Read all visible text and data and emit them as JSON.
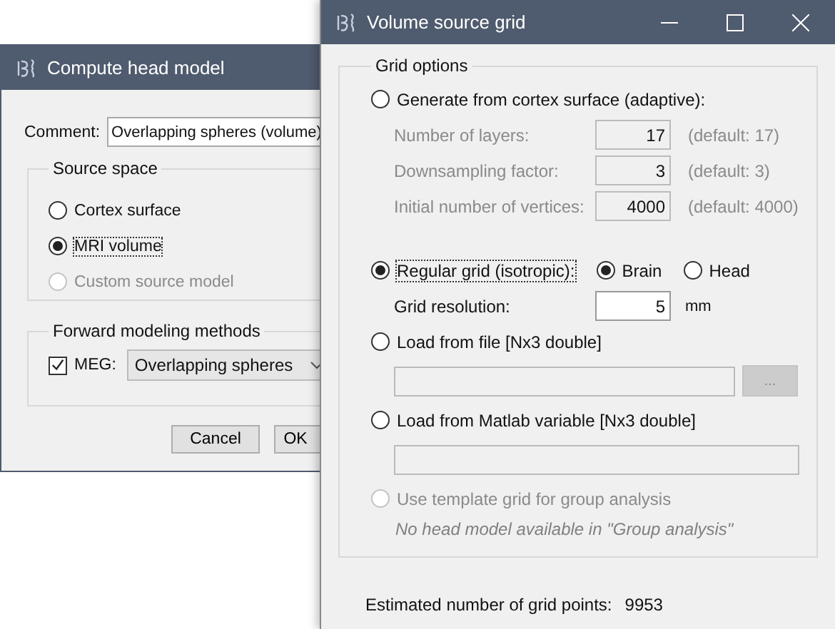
{
  "compute_window": {
    "title": "Compute head model",
    "comment": {
      "label": "Comment:",
      "value": "Overlapping spheres (volume)"
    },
    "source_space": {
      "title": "Source space",
      "options": [
        {
          "label": "Cortex surface",
          "selected": false,
          "disabled": false,
          "focused": false
        },
        {
          "label": "MRI volume",
          "selected": true,
          "disabled": false,
          "focused": true
        },
        {
          "label": "Custom source model",
          "selected": false,
          "disabled": true,
          "focused": false
        }
      ]
    },
    "forward": {
      "title": "Forward modeling methods",
      "meg": {
        "label": "MEG:",
        "checked": true,
        "method": "Overlapping spheres"
      }
    },
    "buttons": [
      "Cancel",
      "OK"
    ]
  },
  "grid_window": {
    "title": "Volume source grid",
    "group_title": "Grid options",
    "cortex": {
      "label": "Generate from cortex surface (adaptive):",
      "selected": false,
      "params": [
        {
          "label": "Number of layers:",
          "value": "17",
          "default": "(default: 17)"
        },
        {
          "label": "Downsampling factor:",
          "value": "3",
          "default": "(default: 3)"
        },
        {
          "label": "Initial number of vertices:",
          "value": "4000",
          "default": "(default: 4000)"
        }
      ]
    },
    "regular": {
      "label": "Regular grid (isotropic):",
      "selected": true,
      "focused": true,
      "scopes": [
        {
          "label": "Brain",
          "selected": true
        },
        {
          "label": "Head",
          "selected": false
        }
      ],
      "resolution": {
        "label": "Grid resolution:",
        "value": "5",
        "unit": "mm"
      }
    },
    "file": {
      "label": "Load from file [Nx3 double]",
      "selected": false,
      "browse": "..."
    },
    "matlab": {
      "label": "Load from Matlab variable [Nx3 double]",
      "selected": false
    },
    "template": {
      "label": "Use template grid for group analysis",
      "selected": false,
      "disabled": true,
      "note": "No head model available in \"Group analysis\""
    },
    "estimate": {
      "label": "Estimated number of grid points:",
      "value": "9953"
    }
  }
}
